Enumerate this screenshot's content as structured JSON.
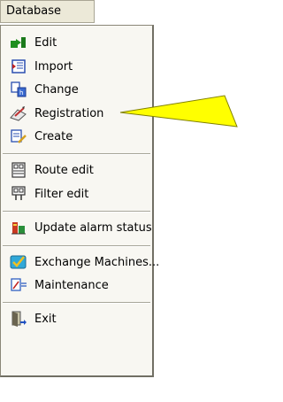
{
  "menubar": {
    "title": "Database"
  },
  "menu": {
    "items": [
      {
        "label": "Edit",
        "icon": "edit-icon"
      },
      {
        "label": "Import",
        "icon": "import-icon"
      },
      {
        "label": "Change",
        "icon": "change-icon"
      },
      {
        "label": "Registration",
        "icon": "registration-icon"
      },
      {
        "label": "Create",
        "icon": "create-icon"
      },
      {
        "label": "Route edit",
        "icon": "route-edit-icon"
      },
      {
        "label": "Filter edit",
        "icon": "filter-edit-icon"
      },
      {
        "label": "Update alarm status",
        "icon": "update-alarm-status-icon"
      },
      {
        "label": "Exchange Machines...",
        "icon": "exchange-machines-icon"
      },
      {
        "label": "Maintenance",
        "icon": "maintenance-icon"
      },
      {
        "label": "Exit",
        "icon": "exit-icon"
      }
    ]
  },
  "callout": {
    "color": "#ffff00",
    "border": "#808000"
  }
}
